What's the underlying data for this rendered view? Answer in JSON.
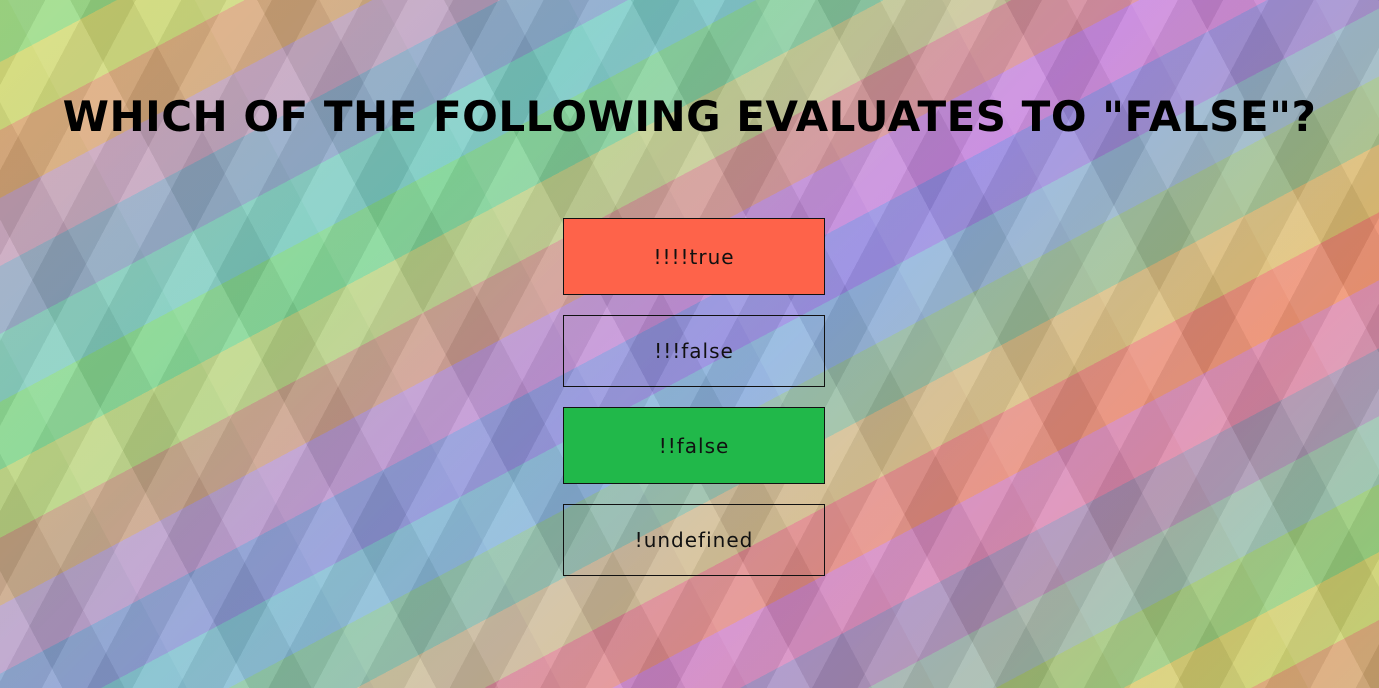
{
  "quiz": {
    "question": "WHICH OF THE FOLLOWING EVALUATES TO \"FALSE\"?",
    "answers": [
      {
        "label": "!!!!true",
        "state": "incorrect",
        "color": "#fe634a"
      },
      {
        "label": "!!!false",
        "state": "neutral",
        "color": "transparent"
      },
      {
        "label": "!!false",
        "state": "correct",
        "color": "#21b84a"
      },
      {
        "label": "!undefined",
        "state": "neutral",
        "color": "transparent"
      }
    ]
  }
}
